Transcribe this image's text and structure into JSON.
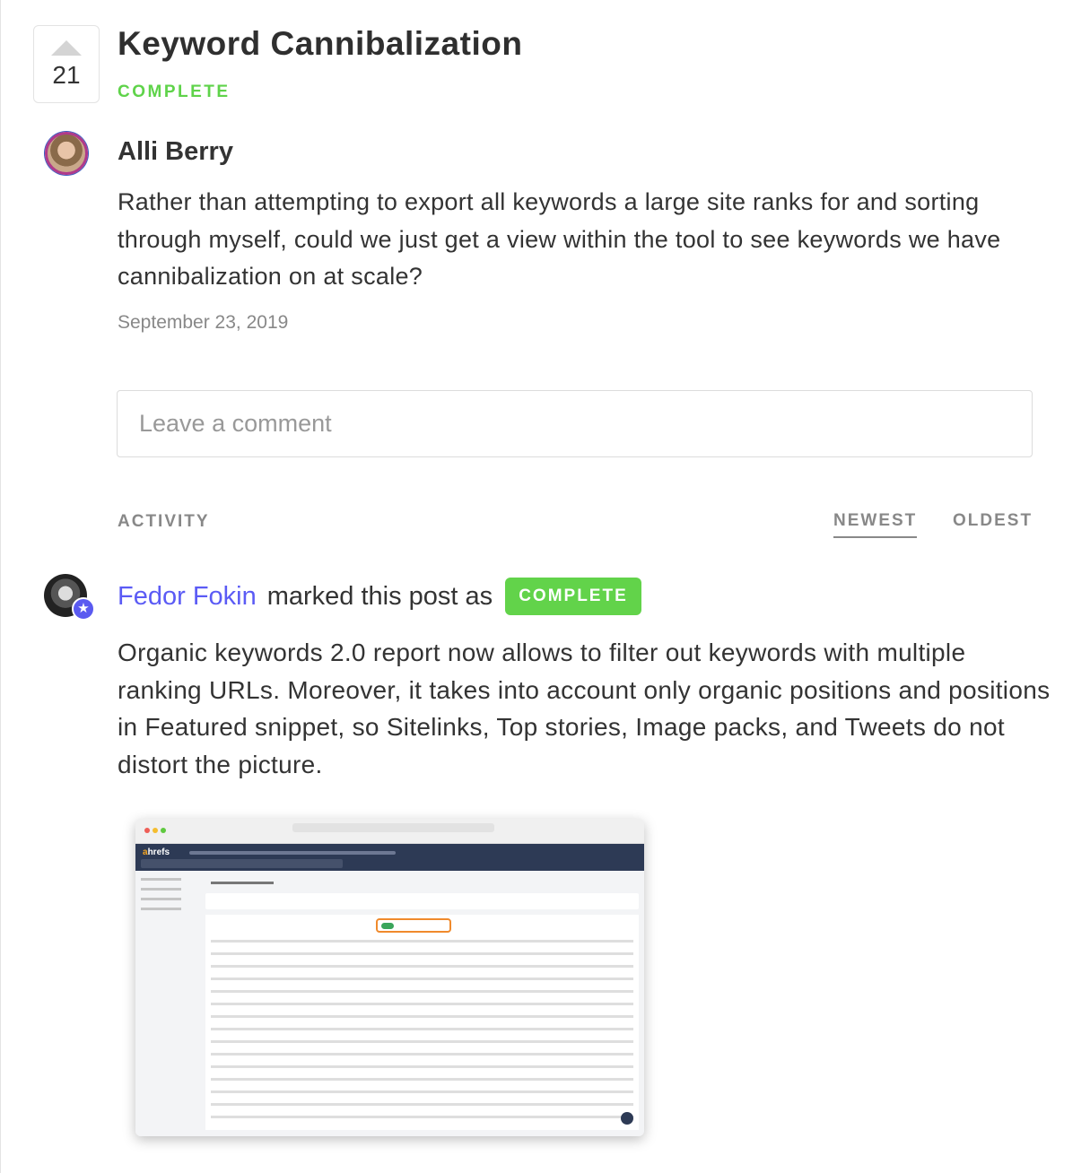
{
  "post": {
    "votes": "21",
    "title": "Keyword Cannibalization",
    "status": "COMPLETE",
    "author": "Alli Berry",
    "body": "Rather than attempting to export all keywords a large site ranks for and sorting through myself, could we just get a view within the tool to see keywords we have cannibalization on at scale?",
    "date": "September 23, 2019"
  },
  "comment": {
    "placeholder": "Leave a comment"
  },
  "activity": {
    "label": "ACTIVITY",
    "sort": {
      "newest": "NEWEST",
      "oldest": "OLDEST",
      "selected": "NEWEST"
    },
    "entry": {
      "user": "Fedor Fokin",
      "action": "marked this post as",
      "badge": "COMPLETE",
      "body": "Organic keywords 2.0 report now allows to filter out keywords with multiple ranking URLs. Moreover, it takes into account only organic positions and positions in Featured snippet, so Sitelinks, Top stories, Image packs, and Tweets do not distort the picture.",
      "screenshot_logo": "ahrefs"
    }
  },
  "colors": {
    "complete": "#62d34a",
    "link": "#5b5bf5",
    "admin_badge": "#5a5af0"
  }
}
